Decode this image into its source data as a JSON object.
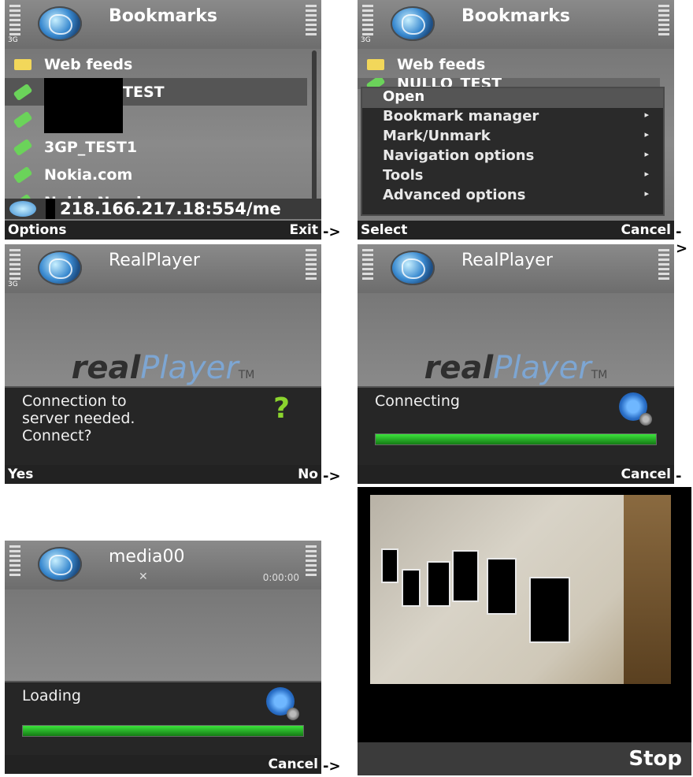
{
  "screens": [
    {
      "title": "Bookmarks",
      "network_tag": "3G",
      "items": [
        {
          "label": "Web feeds"
        },
        {
          "label": "TEST"
        },
        {
          "label": ""
        },
        {
          "label": "3GP_TEST1"
        },
        {
          "label": "Nokia.com"
        },
        {
          "label": "Nokia Nseries"
        }
      ],
      "address": "218.166.217.18:554/me",
      "soft_left": "Options",
      "soft_right": "Exit"
    },
    {
      "title": "Bookmarks",
      "network_tag": "3G",
      "items": [
        {
          "label": "Web feeds"
        },
        {
          "label": "NULLO_TEST"
        }
      ],
      "menu": [
        {
          "label": "Open"
        },
        {
          "label": "Bookmark manager",
          "submenu": "▸"
        },
        {
          "label": "Mark/Unmark",
          "submenu": "▸"
        },
        {
          "label": "Navigation options",
          "submenu": "▸"
        },
        {
          "label": "Tools",
          "submenu": "▸"
        },
        {
          "label": "Advanced options",
          "submenu": "▸"
        }
      ],
      "soft_left": "Select",
      "soft_right": "Cancel"
    },
    {
      "title": "RealPlayer",
      "network_tag": "3G",
      "logo": {
        "part1": "real",
        "part2": "Player",
        "tm": "TM"
      },
      "dialog": [
        "Connection to",
        "server needed.",
        "Connect?"
      ],
      "icon": "question-mark",
      "soft_left": "Yes",
      "soft_right": "No"
    },
    {
      "title": "RealPlayer",
      "logo": {
        "part1": "real",
        "part2": "Player",
        "tm": "TM"
      },
      "dialog": [
        "Connecting"
      ],
      "progress": 1.0,
      "icon": "gear",
      "soft_left": "",
      "soft_right": "Cancel"
    },
    {
      "title": "media00",
      "timer": "0:00:00",
      "dialog": [
        "Loading"
      ],
      "progress": 1.0,
      "icon": "gear",
      "soft_left": "",
      "soft_right": "Cancel"
    },
    {
      "soft_right": "Stop"
    }
  ],
  "arrows": [
    "->",
    "->",
    "->",
    "->",
    "->"
  ]
}
